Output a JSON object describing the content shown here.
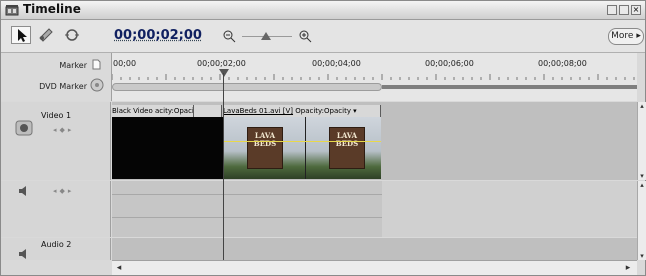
{
  "window": {
    "title": "Timeline"
  },
  "toolbar": {
    "timecode": "00;00;02;00",
    "more_label": "More ▸",
    "tools": [
      "selection-tool",
      "razor-tool",
      "hand-tool"
    ]
  },
  "ruler": {
    "marker_label": "Marker",
    "dvd_marker_label": "DVD Marker",
    "timecodes": [
      "00;00",
      "00;00;02;00",
      "00;00;04;00",
      "00;00;06;00",
      "00;00;08;00"
    ]
  },
  "tracks": {
    "video1": {
      "name": "Video 1"
    },
    "audio1": {
      "name": ""
    },
    "audio2": {
      "name": "Audio 2"
    }
  },
  "clips": [
    {
      "title": "Black Video",
      "fx": "acity:Opacity ▾"
    },
    {
      "title": "LavaBeds 01.avi [V]",
      "fx": "Opacity:Opacity ▾"
    }
  ],
  "sign_text": [
    "LAVA",
    "BEDS"
  ],
  "colors": {
    "timecode": "#102060",
    "clip_black": "#050505",
    "track_bg": "#bfbfbf"
  }
}
